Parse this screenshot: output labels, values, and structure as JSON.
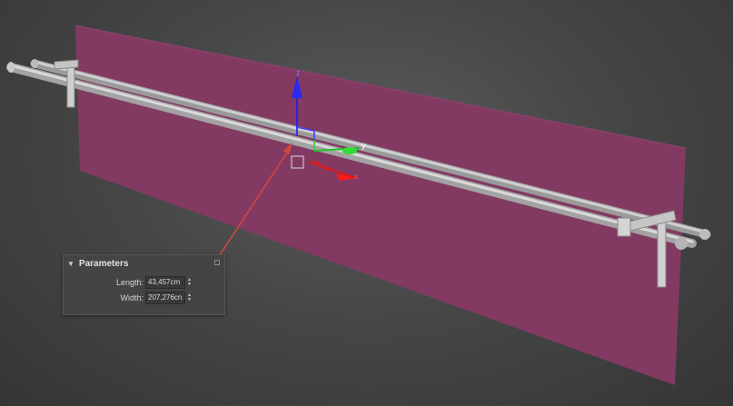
{
  "viewport": {
    "gizmo": {
      "axis_x_label": "x",
      "axis_y_label": "y",
      "axis_z_label": "z"
    }
  },
  "parameters": {
    "title": "Parameters",
    "length_label": "Length:",
    "length_value": "43,457cm",
    "width_label": "Width:",
    "width_value": "207,276cn"
  },
  "colors": {
    "plane": "#823a63",
    "rod": "#bdbdbd",
    "callout": "#d9473a",
    "axis_x": "#e01616",
    "axis_y": "#22c22a",
    "axis_z": "#2222e8"
  }
}
